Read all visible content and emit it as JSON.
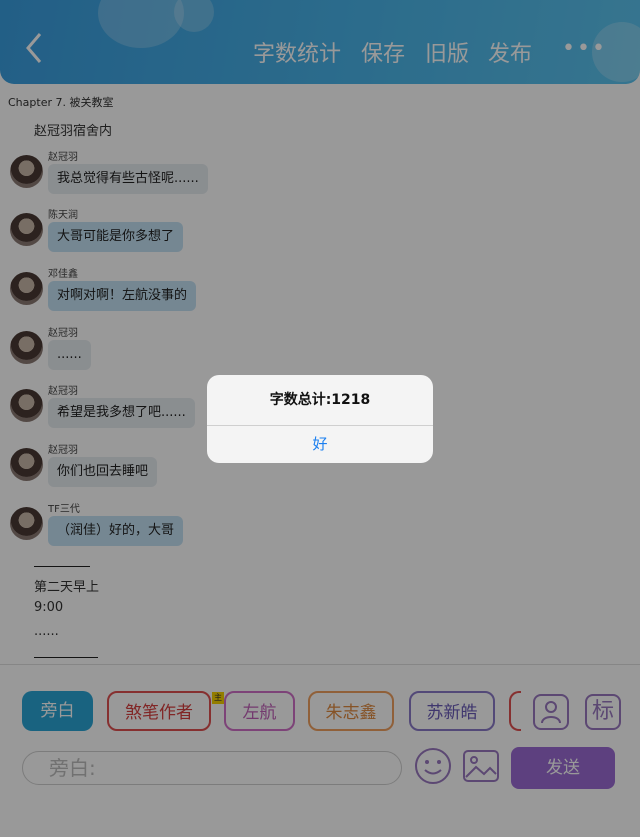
{
  "header": {
    "back_icon": "back-chevron-icon",
    "buttons": [
      "字数统计",
      "保存",
      "旧版",
      "发布"
    ],
    "more_label": "•••"
  },
  "chapter": "Chapter 7. 被关教室",
  "scene": "赵冠羽宿舍内",
  "messages": [
    {
      "sender": "赵冠羽",
      "text": "我总觉得有些古怪呢......",
      "style": "gray"
    },
    {
      "sender": "陈天润",
      "text": "大哥可能是你多想了",
      "style": "blue"
    },
    {
      "sender": "邓佳鑫",
      "text": "对啊对啊！左航没事的",
      "style": "blue"
    },
    {
      "sender": "赵冠羽",
      "text": "......",
      "style": "gray"
    },
    {
      "sender": "赵冠羽",
      "text": "希望是我多想了吧......",
      "style": "gray"
    },
    {
      "sender": "赵冠羽",
      "text": "你们也回去睡吧",
      "style": "gray"
    },
    {
      "sender": "TF三代",
      "text": "（润佳）好的，大哥",
      "style": "blue"
    }
  ],
  "tail": {
    "line1": "第二天早上",
    "line2": "9:00",
    "line3": "......"
  },
  "dialog": {
    "title": "字数总计:1218",
    "ok": "好"
  },
  "roles": [
    {
      "label": "旁白",
      "active": true
    },
    {
      "label": "煞笔作者",
      "badge": "主"
    },
    {
      "label": "左航"
    },
    {
      "label": "朱志鑫"
    },
    {
      "label": "苏新皓"
    }
  ],
  "icons": {
    "person": "person-icon",
    "tag_label": "标"
  },
  "input": {
    "placeholder": "旁白:"
  },
  "send_label": "发送",
  "colors": {
    "header": "#4bb6ea",
    "narration_active": "#2aa6d6",
    "send": "#9b6bd4",
    "dialog_ok": "#1a7ff0"
  }
}
